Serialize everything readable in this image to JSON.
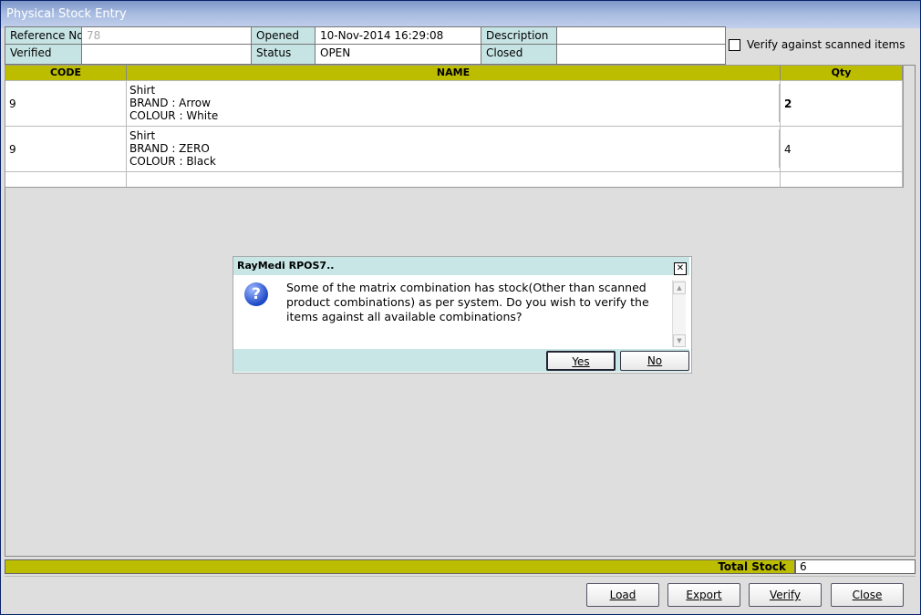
{
  "window": {
    "title": "Physical Stock Entry"
  },
  "header": {
    "reference_label": "Reference No",
    "reference_value": "78",
    "opened_label": "Opened",
    "opened_value": "10-Nov-2014 16:29:08",
    "description_label": "Description",
    "description_value": "",
    "verified_label": "Verified",
    "verified_value": "",
    "status_label": "Status",
    "status_value": "OPEN",
    "closed_label": "Closed",
    "closed_value": ""
  },
  "verify_option": {
    "label": "Verify against scanned items",
    "checked": false
  },
  "table": {
    "columns": [
      "CODE",
      "NAME",
      "Qty"
    ],
    "rows": [
      {
        "code": "9",
        "name_line1": "Shirt",
        "name_line2": "BRAND : Arrow",
        "name_line3": "COLOUR : White",
        "qty": "2"
      },
      {
        "code": "9",
        "name_line1": "Shirt",
        "name_line2": "BRAND : ZERO",
        "name_line3": "COLOUR : Black",
        "qty": "4"
      }
    ]
  },
  "totals": {
    "label": "Total Stock",
    "value": "6"
  },
  "buttons": {
    "load": "Load",
    "export": "Export",
    "verify": "Verify",
    "close": "Close"
  },
  "dialog": {
    "title": "RayMedi RPOS7..",
    "message": "Some of the matrix combination has stock(Other than scanned product combinations) as per system. Do you wish to verify the items against all available combinations?",
    "yes": "Yes",
    "no": "No",
    "icon": "question-icon"
  },
  "colors": {
    "header_bar": "#bdbd00",
    "label_bg": "#c7e4e4",
    "dialog_accent": "#c8e6e6"
  }
}
